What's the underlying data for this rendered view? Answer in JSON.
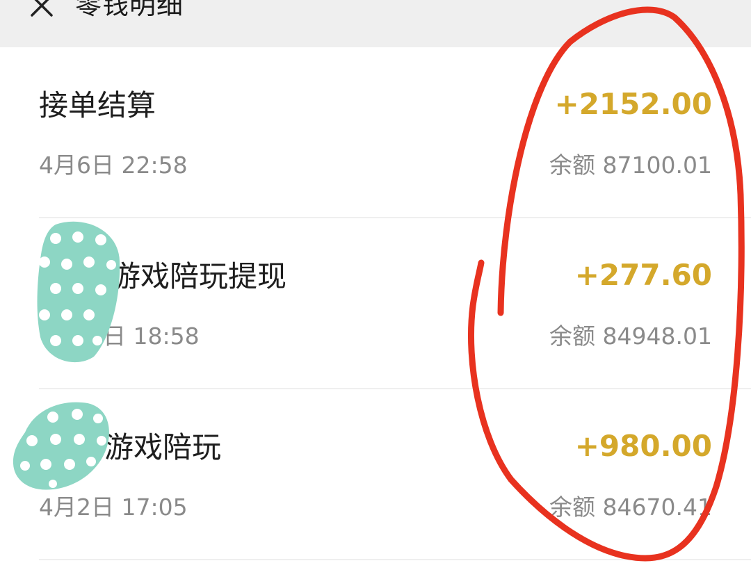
{
  "header": {
    "title": "零钱明细",
    "close_icon": "close-icon"
  },
  "transactions": [
    {
      "title": "接单结算",
      "time": "4月6日 22:58",
      "amount": "+2152.00",
      "balance": "余额 87100.01"
    },
    {
      "title": "游戏陪玩提现",
      "time": "日 18:58",
      "amount": "+277.60",
      "balance": "余额 84948.01"
    },
    {
      "title": "游戏陪玩",
      "time": "4月2日 17:05",
      "amount": "+980.00",
      "balance": "余额 84670.41"
    }
  ],
  "colors": {
    "amount": "#d4a82b",
    "secondary_text": "#8a8a8a",
    "header_bg": "#efefef",
    "annotation": "#e8321f",
    "sticker": "#8dd6c4"
  }
}
